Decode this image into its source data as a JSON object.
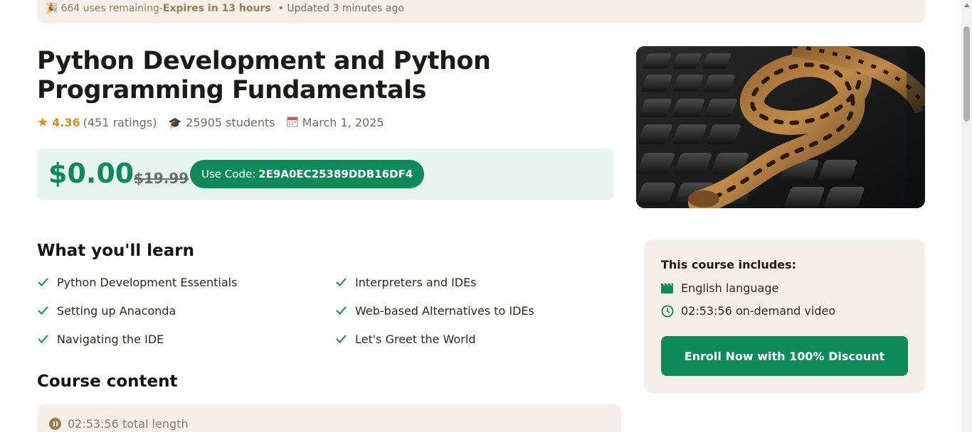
{
  "promo_bar": {
    "uses_remaining": "664 uses remaining",
    "separator": " - ",
    "expires": "Expires in 13 hours",
    "updated": "• Updated 3 minutes ago"
  },
  "course": {
    "title": "Python Development and Python Programming Fundamentals",
    "rating": "4.36",
    "ratings_count": "(451 ratings)",
    "students": "25905 students",
    "date": "March 1, 2025"
  },
  "pricing": {
    "price": "$0.00",
    "old_price": "$19.99",
    "code_label": "Use Code:",
    "code": "2E9A0EC25389DDB16DF4"
  },
  "learn": {
    "heading": "What you'll learn",
    "items": [
      "Python Development Essentials",
      "Interpreters and IDEs",
      "Setting up Anaconda",
      "Web-based Alternatives to IDEs",
      "Navigating the IDE",
      "Let's Greet the World"
    ]
  },
  "course_content": {
    "heading": "Course content",
    "total_length": "02:53:56 total length"
  },
  "sidebar": {
    "heading": "This course includes:",
    "language": "English language",
    "video": "02:53:56 on-demand video",
    "enroll_label": "Enroll Now with 100% Discount"
  },
  "colors": {
    "accent": "#0e8a5a",
    "rating": "#e08a1e",
    "panel": "#f3efe8"
  }
}
